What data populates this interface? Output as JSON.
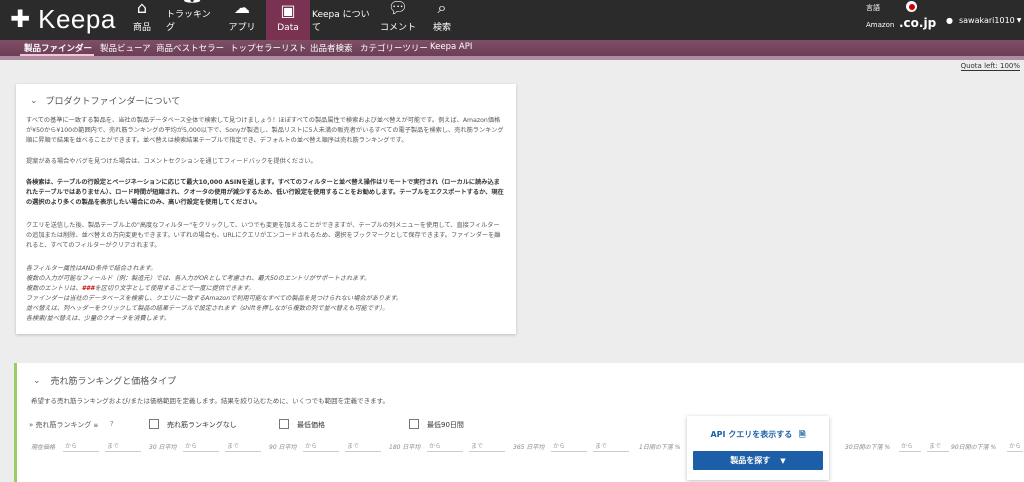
{
  "topnav": {
    "brand": "Keepa",
    "items": [
      {
        "label": "商品",
        "icon": "home-icon"
      },
      {
        "label": "トラッキング",
        "icon": "bell-icon"
      },
      {
        "label": "アプリ",
        "icon": "cloud-download-icon"
      },
      {
        "label": "Data",
        "icon": "cube-icon"
      },
      {
        "label": "Keepa について",
        "icon": "info-icon"
      },
      {
        "label": "コメント",
        "icon": "comment-icon"
      },
      {
        "label": "検索",
        "icon": "search-icon"
      }
    ],
    "language_label": "言語",
    "locale_label": "Amazon",
    "locale_value": ".co.jp",
    "username": "sawakari1010"
  },
  "subnav": {
    "items": [
      "製品ファインダー",
      "製品ビューア",
      "商品ベストセラー",
      "トップセラーリスト",
      "出品者検索",
      "カテゴリーツリー",
      "Keepa API"
    ]
  },
  "quota": "Quota left: 100%",
  "about": {
    "title": "プロダクトファインダーについて",
    "p1": "すべての基準に一致する製品を、当社の製品データベース全体で検索して見つけましょう！ほぼすべての製品属性で検索および並べ替えが可能です。例えば、Amazon価格が¥50から¥100の範囲内で、売れ筋ランキングの平均が5,000以下で、Sonyが製造し、製品リストに5人未満の販売者がいるすべての電子製品を検索し、売れ筋ランキング順に昇順で結果を並べることができます。並べ替えは検索結果テーブルで指定でき、デフォルトの並べ替え順序は売れ筋ランキングです。",
    "p1b": "提案がある場合やバグを見つけた場合は、コメントセクションを通じてフィードバックを提供ください。",
    "p2": "各検索は、テーブルの行設定とページネーションに応じて最大10,000 ASINを返します。すべてのフィルターと並べ替え操作はリモートで実行され（ローカルに読み込まれたテーブルではありません）、ロード時間が短縮され、クオータの使用が減少するため、低い行設定を使用することをお勧めします。テーブルをエクスポートするか、現在の選択のより多くの製品を表示したい場合にのみ、高い行設定を使用してください。",
    "p3": "クエリを送信した後、製品テーブル上の\"高度なフィルター\"をクリックして、いつでも変更を加えることができますが、テーブルの列メニューを使用して、直接フィルターの追加または削除、並べ替えの方向変更もできます。いずれの場合も、URLにクエリがエンコードされるため、選択をブックマークとして保存できます。ファインダーを離れると、すべてのフィルターがクリアされます。",
    "notes": [
      "各フィルター属性はAND条件で結合されます。",
      "複数の入力が可能なフィールド（例：製造元）では、各入力がORとして考慮され、最大50のエントリがサポートされます。",
      "複数のエントリは、",
      "###",
      "を区切り文字として使用することで一度に提供できます。",
      "ファインダーは当社のデータベースを検索し、クエリに一致するAmazonで利用可能なすべての製品を見つけられない場合があります。",
      "並べ替えは、列ヘッダーをクリックして製品の結果テーブルで設定されます（shiftを押しながら複数の列で並べ替えも可能です）。",
      "各検索/並べ替えは、少量のクオータを消費します。"
    ]
  },
  "rank_section": {
    "title": "売れ筋ランキングと価格タイプ",
    "description": "希望する売れ筋ランキングおよび/または価格範囲を定義します。結果を絞り込むために、いくつでも範囲を定義できます。",
    "rank_label": "売れ筋ランキング",
    "help": "?",
    "checkboxes": [
      "売れ筋ランキングなし",
      "最低価格",
      "最低90日間"
    ],
    "ranges": [
      {
        "label": "現在価格",
        "from": "から",
        "to": "まで"
      },
      {
        "label": "30 日平均",
        "from": "から",
        "to": "まで"
      },
      {
        "label": "90 日平均",
        "from": "から",
        "to": "まで"
      },
      {
        "label": "180 日平均",
        "from": "から",
        "to": "まで"
      },
      {
        "label": "365 日平均",
        "from": "から",
        "to": "まで"
      },
      {
        "label": "1日間の下落 %",
        "from": "から",
        "to": "まで"
      },
      {
        "label": "30日間の下落 %",
        "from": "から",
        "to": "まで"
      },
      {
        "label": "90日間の下落 %",
        "from": "から",
        "to": ""
      }
    ]
  },
  "api_popover": {
    "link": "API クエリを表示する",
    "find_button": "製品を探す"
  }
}
